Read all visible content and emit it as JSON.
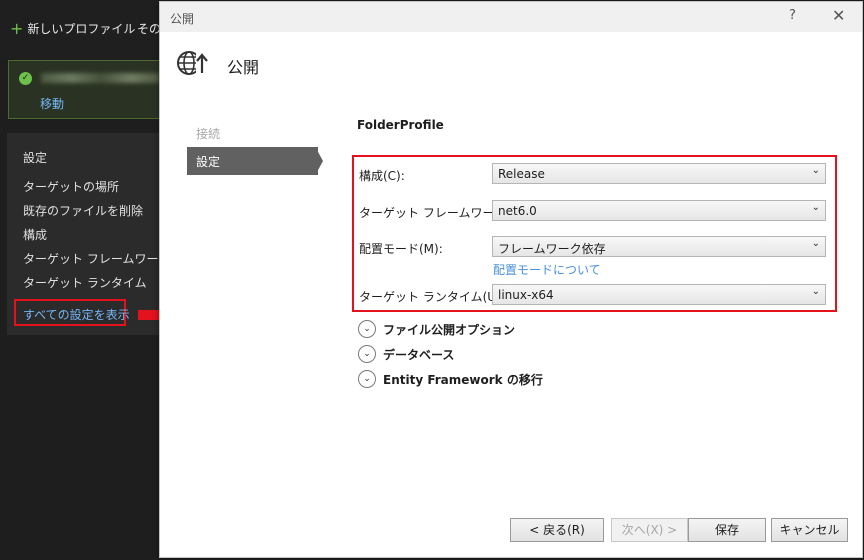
{
  "background": {
    "new_profile_label": "新しいプロファイル",
    "other_label": "その",
    "success_action": "移動",
    "settings_title": "設定",
    "settings_items": [
      "ターゲットの場所",
      "既存のファイルを削除",
      "構成",
      "ターゲット フレームワーク",
      "ターゲット ランタイム"
    ],
    "show_all_label": "すべての設定を表示"
  },
  "dialog": {
    "window_title": "公開",
    "help_glyph": "?",
    "close_glyph": "✕",
    "heading": "公開",
    "steps": [
      {
        "label": "接続",
        "active": false
      },
      {
        "label": "設定",
        "active": true
      }
    ],
    "profile_name": "FolderProfile",
    "fields": {
      "configuration": {
        "label": "構成(C):",
        "value": "Release"
      },
      "framework": {
        "label": "ターゲット フレームワーク(F):",
        "value": "net6.0"
      },
      "deploy_mode": {
        "label": "配置モード(M):",
        "value": "フレームワーク依存"
      },
      "runtime": {
        "label": "ターゲット ランタイム(U):",
        "value": "linux-x64"
      }
    },
    "deploy_mode_link": "配置モードについて",
    "expanders": [
      "ファイル公開オプション",
      "データベース",
      "Entity Framework の移行"
    ],
    "buttons": {
      "back": "< 戻る(R)",
      "next": "次へ(X) >",
      "save": "保存",
      "cancel": "キャンセル"
    }
  },
  "colors": {
    "highlight_red": "#e4121d",
    "link_blue": "#4a90d9",
    "success_green": "#6cc24a"
  }
}
